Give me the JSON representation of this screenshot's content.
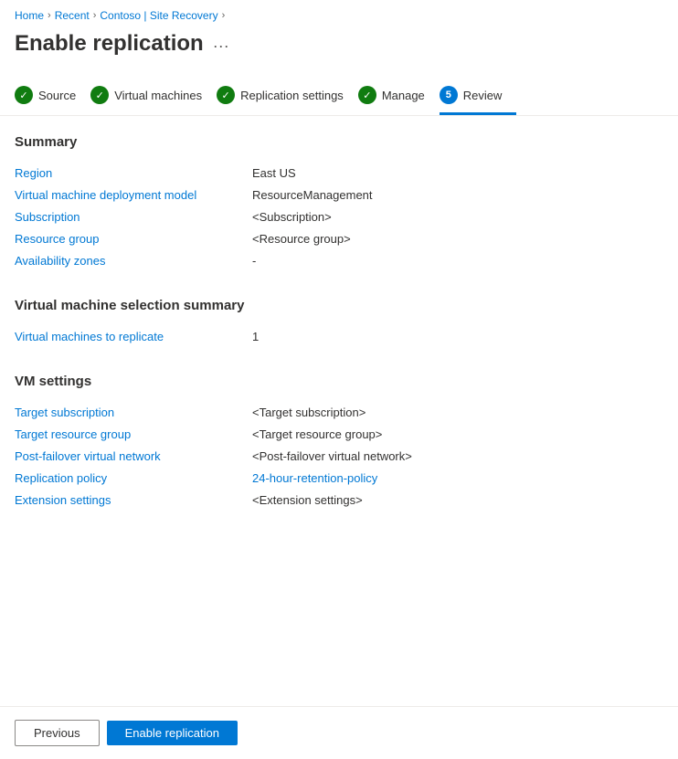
{
  "breadcrumb": {
    "items": [
      {
        "label": "Home",
        "link": true
      },
      {
        "label": "Recent",
        "link": true
      },
      {
        "label": "Contoso | Site Recovery",
        "link": true,
        "accent": true
      }
    ],
    "separator": ">"
  },
  "page": {
    "title": "Enable replication",
    "menu_icon": "···"
  },
  "wizard": {
    "steps": [
      {
        "label": "Source",
        "status": "complete",
        "num": null
      },
      {
        "label": "Virtual machines",
        "status": "complete",
        "num": null
      },
      {
        "label": "Replication settings",
        "status": "complete",
        "num": null
      },
      {
        "label": "Manage",
        "status": "complete",
        "num": null
      },
      {
        "label": "Review",
        "status": "active",
        "num": "5"
      }
    ]
  },
  "summary_section": {
    "title": "Summary",
    "rows": [
      {
        "label": "Region",
        "value": "East US"
      },
      {
        "label": "Virtual machine deployment model",
        "value": "ResourceManagement"
      },
      {
        "label": "Subscription",
        "value": "<Subscription>"
      },
      {
        "label": "Resource group",
        "value": "<Resource group>"
      },
      {
        "label": "Availability zones",
        "value": "-"
      }
    ]
  },
  "vm_selection_section": {
    "title": "Virtual machine selection summary",
    "rows": [
      {
        "label": "Virtual machines to replicate",
        "value": "1"
      }
    ]
  },
  "vm_settings_section": {
    "title": "VM settings",
    "rows": [
      {
        "label": "Target subscription",
        "value": "<Target subscription>"
      },
      {
        "label": "Target resource group",
        "value": "<Target resource group>"
      },
      {
        "label": "Post-failover virtual network",
        "value": "<Post-failover virtual network>"
      },
      {
        "label": "Replication policy",
        "value": "24-hour-retention-policy",
        "value_link": true
      },
      {
        "label": "Extension settings",
        "value": "<Extension settings>"
      }
    ]
  },
  "footer": {
    "previous_label": "Previous",
    "enable_label": "Enable replication"
  }
}
